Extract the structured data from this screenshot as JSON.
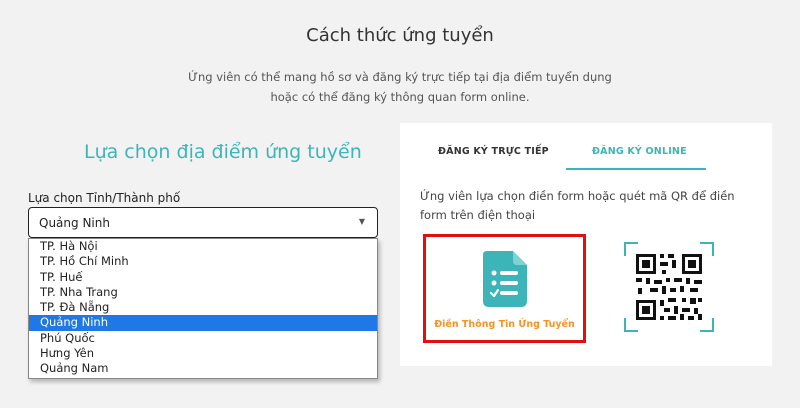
{
  "header": {
    "title": "Cách thức ứng tuyển",
    "intro_line1": "Ứng viên có thể mang hồ sơ và đăng ký trực tiếp tại địa điểm tuyển dụng",
    "intro_line2": "hoặc có thể đăng ký thông quan form online."
  },
  "location": {
    "heading": "Lựa chọn địa điểm ứng tuyển",
    "select_label": "Lựa chọn Tỉnh/Thành phố",
    "selected_value": "Quảng Ninh",
    "options": [
      {
        "label": "TP. Hà Nội"
      },
      {
        "label": "TP. Hồ Chí Minh"
      },
      {
        "label": "TP. Huế"
      },
      {
        "label": "TP. Nha Trang"
      },
      {
        "label": "TP. Đà Nẵng"
      },
      {
        "label": "Quảng Ninh"
      },
      {
        "label": "Phú Quốc"
      },
      {
        "label": "Hưng Yên"
      },
      {
        "label": "Quảng Nam"
      }
    ]
  },
  "registration": {
    "tabs": [
      {
        "label": "ĐĂNG KÝ TRỰC TIẾP"
      },
      {
        "label": "ĐĂNG KÝ ONLINE"
      }
    ],
    "description": "Ứng viên lựa chọn điền form hoặc quét mã QR để điền form trên điện thoại",
    "form_caption": "Điền Thông Tin Ứng Tuyển",
    "form_icon": "form-checklist-icon",
    "qr_icon": "qr-code-icon"
  },
  "colors": {
    "accent": "#3db5b8",
    "highlight_border": "#e01010",
    "caption": "#f7931e",
    "selected_option": "#1e78e6"
  }
}
